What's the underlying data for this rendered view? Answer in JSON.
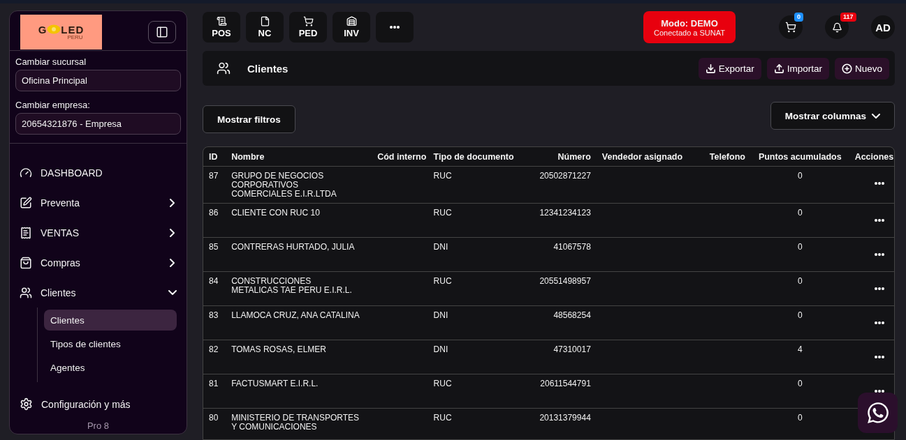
{
  "logo": {
    "start": "G",
    "end": "LED",
    "sub": "PERU"
  },
  "branch": {
    "label": "Cambiar sucursal",
    "value": "Oficina Principal"
  },
  "company": {
    "label": "Cambiar empresa:",
    "value": "20654321876 - Empresa"
  },
  "nav": [
    {
      "label": "DASHBOARD",
      "kind": "link"
    },
    {
      "label": "Preventa",
      "kind": "group",
      "expanded": false
    },
    {
      "label": "VENTAS",
      "kind": "group",
      "expanded": false
    },
    {
      "label": "Compras",
      "kind": "group",
      "expanded": false
    },
    {
      "label": "Clientes",
      "kind": "group",
      "expanded": true,
      "children": [
        {
          "label": "Clientes",
          "selected": true
        },
        {
          "label": "Tipos de clientes",
          "selected": false
        },
        {
          "label": "Agentes",
          "selected": false
        }
      ]
    }
  ],
  "settings": {
    "label": "Configuración y más"
  },
  "version": "Pro 8",
  "shortcuts": [
    {
      "kind": "label",
      "label": "POS"
    },
    {
      "kind": "label",
      "label": "NC"
    },
    {
      "kind": "label",
      "label": "PED"
    },
    {
      "kind": "label",
      "label": "INV"
    },
    {
      "kind": "more"
    }
  ],
  "mode": {
    "title": "Modo: DEMO",
    "subtitle": "Conectado a SUNAT"
  },
  "cart_badge": "0",
  "bell_badge": "117",
  "avatar": "AD",
  "page_title": "Clientes",
  "actions": [
    {
      "label": "Exportar"
    },
    {
      "label": "Importar"
    },
    {
      "label": "Nuevo"
    }
  ],
  "filters_button": "Mostrar filtros",
  "columns_button": "Mostrar columnas",
  "table": {
    "columns": [
      "ID",
      "Nombre",
      "Cód interno",
      "Tipo de documento",
      "Número",
      "Vendedor asignado",
      "Telefono",
      "Puntos acumulados",
      "Acciones"
    ],
    "rows": [
      [
        "87",
        "GRUPO DE NEGOCIOS CORPORATIVOS COMERCIALES E.I.R.LTDA",
        "",
        "RUC",
        "20502871227",
        "",
        "",
        "0"
      ],
      [
        "86",
        "CLIENTE CON RUC 10",
        "",
        "RUC",
        "12341234123",
        "",
        "",
        "0"
      ],
      [
        "85",
        "CONTRERAS HURTADO, JULIA",
        "",
        "DNI",
        "41067578",
        "",
        "",
        "0"
      ],
      [
        "84",
        "CONSTRUCCIONES METALICAS TAE PERU E.I.R.L.",
        "",
        "RUC",
        "20551498957",
        "",
        "",
        "0"
      ],
      [
        "83",
        "LLAMOCA CRUZ, ANA CATALINA",
        "",
        "DNI",
        "48568254",
        "",
        "",
        "0"
      ],
      [
        "82",
        "TOMAS ROSAS, ELMER",
        "",
        "DNI",
        "47310017",
        "",
        "",
        "4"
      ],
      [
        "81",
        "FACTUSMART E.I.R.L.",
        "",
        "RUC",
        "20611544791",
        "",
        "",
        "0"
      ],
      [
        "80",
        "MINISTERIO DE TRANSPORTES Y COMUNICACIONES",
        "",
        "RUC",
        "20131379944",
        "",
        "",
        "0"
      ]
    ]
  }
}
